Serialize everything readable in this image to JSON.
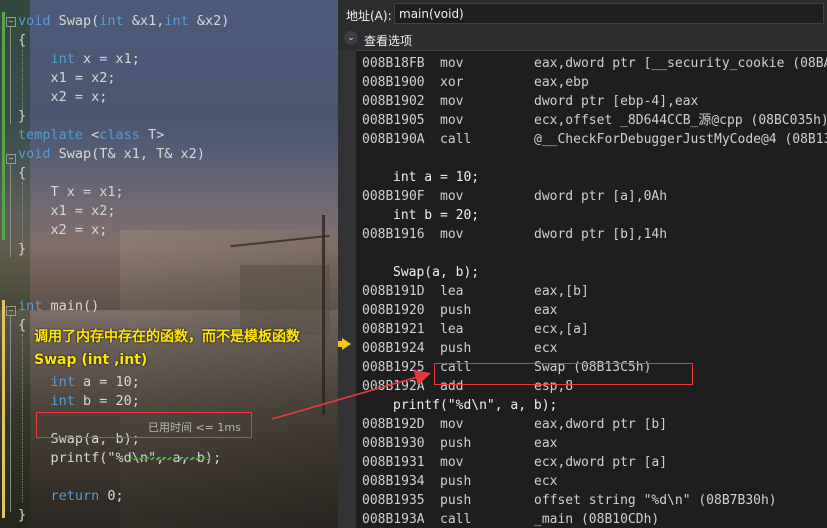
{
  "source": {
    "lines": [
      {
        "tokens": [
          {
            "t": "void",
            "k": true
          },
          {
            "t": " Swap(",
            "k": false
          },
          {
            "t": "int",
            "k": true
          },
          {
            "t": " &x1,",
            "k": false
          },
          {
            "t": "int",
            "k": true
          },
          {
            "t": " &x2)",
            "k": false
          }
        ]
      },
      {
        "tokens": [
          {
            "t": "{",
            "k": false
          }
        ]
      },
      {
        "tokens": [
          {
            "t": "    ",
            "k": false
          },
          {
            "t": "int",
            "k": true
          },
          {
            "t": " x = x1;",
            "k": false
          }
        ]
      },
      {
        "tokens": [
          {
            "t": "    x1 = x2;",
            "k": false
          }
        ]
      },
      {
        "tokens": [
          {
            "t": "    x2 = x;",
            "k": false
          }
        ]
      },
      {
        "tokens": [
          {
            "t": "}",
            "k": false
          }
        ]
      },
      {
        "tokens": [
          {
            "t": "template",
            "k": true
          },
          {
            "t": " <",
            "k": false
          },
          {
            "t": "class",
            "k": true
          },
          {
            "t": " T>",
            "k": false
          }
        ]
      },
      {
        "tokens": [
          {
            "t": "void",
            "k": true
          },
          {
            "t": " Swap(T& x1, T& x2)",
            "k": false
          }
        ]
      },
      {
        "tokens": [
          {
            "t": "{",
            "k": false
          }
        ]
      },
      {
        "tokens": [
          {
            "t": "    T x = x1;",
            "k": false
          }
        ]
      },
      {
        "tokens": [
          {
            "t": "    x1 = x2;",
            "k": false
          }
        ]
      },
      {
        "tokens": [
          {
            "t": "    x2 = x;",
            "k": false
          }
        ]
      },
      {
        "tokens": [
          {
            "t": "}",
            "k": false
          }
        ]
      },
      {
        "tokens": []
      },
      {
        "tokens": []
      },
      {
        "tokens": [
          {
            "t": "int",
            "k": true
          },
          {
            "t": " main()",
            "k": false
          }
        ]
      },
      {
        "tokens": [
          {
            "t": "{",
            "k": false
          }
        ]
      },
      {
        "tokens": []
      },
      {
        "tokens": []
      },
      {
        "tokens": [
          {
            "t": "    ",
            "k": false
          },
          {
            "t": "int",
            "k": true
          },
          {
            "t": " a = 10;",
            "k": false
          }
        ]
      },
      {
        "tokens": [
          {
            "t": "    ",
            "k": false
          },
          {
            "t": "int",
            "k": true
          },
          {
            "t": " b = 20;",
            "k": false
          }
        ]
      },
      {
        "tokens": []
      },
      {
        "tokens": [
          {
            "t": "    Swap(a, b);",
            "k": false
          }
        ]
      },
      {
        "tokens": [
          {
            "t": "    printf(\"%d\\n\", a, b);",
            "k": false
          }
        ]
      },
      {
        "tokens": []
      },
      {
        "tokens": [
          {
            "t": "    ",
            "k": false
          },
          {
            "t": "return",
            "k": true
          },
          {
            "t": " 0;",
            "k": false
          }
        ]
      },
      {
        "tokens": [
          {
            "t": "}",
            "k": false
          }
        ]
      }
    ],
    "annotation_line1": "调用了内存中存在的函数，而不是模板函数",
    "annotation_line2": "Swap (int ,int)",
    "elapsed": "已用时间 <= 1ms"
  },
  "disassembly": {
    "address_label": "地址(A):",
    "address_value": "main(void)",
    "view_options_label": "查看选项",
    "rows": [
      {
        "kind": "asm",
        "addr": "008B18FB",
        "mn": "mov",
        "op": "eax,dword ptr [__security_cookie (08BA"
      },
      {
        "kind": "asm",
        "addr": "008B1900",
        "mn": "xor",
        "op": "eax,ebp"
      },
      {
        "kind": "asm",
        "addr": "008B1902",
        "mn": "mov",
        "op": "dword ptr [ebp-4],eax"
      },
      {
        "kind": "asm",
        "addr": "008B1905",
        "mn": "mov",
        "op": "ecx,offset _8D644CCB_源@cpp (08BC035h)"
      },
      {
        "kind": "asm",
        "addr": "008B190A",
        "mn": "call",
        "op": "@__CheckForDebuggerJustMyCode@4 (08B13"
      },
      {
        "kind": "blank"
      },
      {
        "kind": "src",
        "text": "int a = 10;"
      },
      {
        "kind": "asm",
        "addr": "008B190F",
        "mn": "mov",
        "op": "dword ptr [a],0Ah"
      },
      {
        "kind": "src",
        "text": "int b = 20;"
      },
      {
        "kind": "asm",
        "addr": "008B1916",
        "mn": "mov",
        "op": "dword ptr [b],14h"
      },
      {
        "kind": "blank"
      },
      {
        "kind": "src",
        "text": "Swap(a, b);"
      },
      {
        "kind": "asm",
        "addr": "008B191D",
        "mn": "lea",
        "op": "eax,[b]"
      },
      {
        "kind": "asm",
        "addr": "008B1920",
        "mn": "push",
        "op": "eax"
      },
      {
        "kind": "asm",
        "addr": "008B1921",
        "mn": "lea",
        "op": "ecx,[a]"
      },
      {
        "kind": "asm",
        "addr": "008B1924",
        "mn": "push",
        "op": "ecx"
      },
      {
        "kind": "asm",
        "addr": "008B1925",
        "mn": "call",
        "op": "Swap (08B13C5h)"
      },
      {
        "kind": "asm",
        "addr": "008B192A",
        "mn": "add",
        "op": "esp,8"
      },
      {
        "kind": "src",
        "text": "printf(\"%d\\n\", a, b);"
      },
      {
        "kind": "asm",
        "addr": "008B192D",
        "mn": "mov",
        "op": "eax,dword ptr [b]"
      },
      {
        "kind": "asm",
        "addr": "008B1930",
        "mn": "push",
        "op": "eax"
      },
      {
        "kind": "asm",
        "addr": "008B1931",
        "mn": "mov",
        "op": "ecx,dword ptr [a]"
      },
      {
        "kind": "asm",
        "addr": "008B1934",
        "mn": "push",
        "op": "ecx"
      },
      {
        "kind": "asm",
        "addr": "008B1935",
        "mn": "push",
        "op": "offset string \"%d\\n\" (08B7B30h)"
      },
      {
        "kind": "asm",
        "addr": "008B193A",
        "mn": "call",
        "op": "_main (08B10CDh)"
      }
    ],
    "current_row_index": 12
  },
  "icons": {
    "options_toggle": "chevron-down-icon",
    "current_instruction": "instruction-pointer-arrow-icon",
    "fold": "collapse-toggle-icon"
  },
  "colors": {
    "keyword": "#569cd6",
    "annotation": "#ffe600",
    "highlight_box": "#e83a3a",
    "instruction_pointer": "#f5c518"
  }
}
